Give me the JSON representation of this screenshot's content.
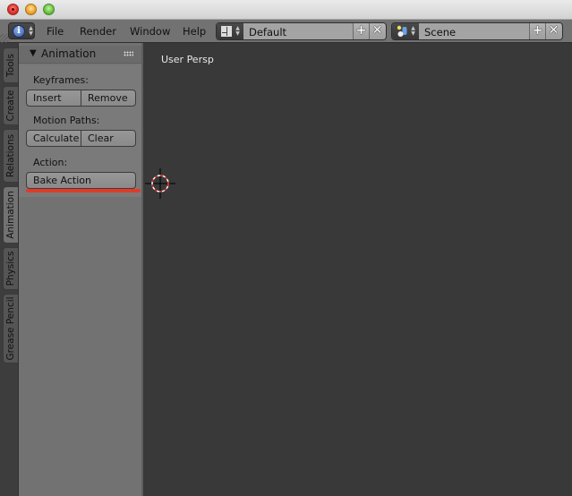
{
  "window": {
    "traffic_lights": [
      "close",
      "minimize",
      "maximize"
    ]
  },
  "header": {
    "editor_type_icon": "info-icon",
    "menus": [
      "File",
      "Render",
      "Window",
      "Help"
    ],
    "screen_layout": {
      "icon": "screen-layout-icon",
      "value": "Default",
      "add_icon": "plus-icon",
      "remove_icon": "close-x-icon"
    },
    "scene": {
      "icon": "scene-icon",
      "value": "Scene",
      "add_icon": "plus-icon",
      "remove_icon": "close-x-icon"
    }
  },
  "tabs": [
    {
      "label": "Tools",
      "active": false
    },
    {
      "label": "Create",
      "active": false
    },
    {
      "label": "Relations",
      "active": false
    },
    {
      "label": "Animation",
      "active": true
    },
    {
      "label": "Physics",
      "active": false
    },
    {
      "label": "Grease Pencil",
      "active": false
    }
  ],
  "panel": {
    "title": "Animation",
    "collapse_icon": "triangle-down-icon",
    "sections": {
      "keyframes": {
        "label": "Keyframes:",
        "buttons": [
          "Insert",
          "Remove"
        ]
      },
      "motion_paths": {
        "label": "Motion Paths:",
        "buttons": [
          "Calculate",
          "Clear"
        ]
      },
      "action": {
        "label": "Action:",
        "buttons": [
          "Bake Action"
        ]
      }
    },
    "highlight_color": "#e23a2a"
  },
  "viewport": {
    "label": "User Persp"
  }
}
